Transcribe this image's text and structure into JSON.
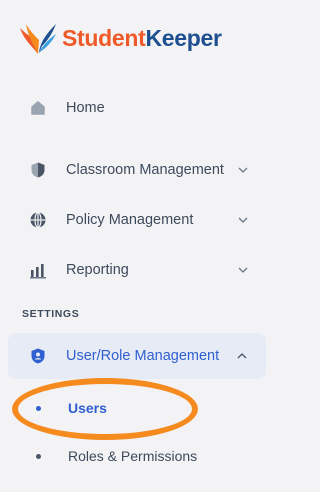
{
  "brand": {
    "part1": "Student",
    "part2": "Keeper"
  },
  "nav": {
    "home": "Home",
    "classroom": "Classroom Management",
    "policy": "Policy Management",
    "reporting": "Reporting"
  },
  "settings": {
    "section_label": "SETTINGS",
    "group_label": "User/Role Management",
    "items": [
      "Users",
      "Roles & Permissions"
    ]
  },
  "colors": {
    "accent": "#2f5fd0",
    "brand_orange": "#f05a28",
    "brand_navy": "#1d4f91",
    "highlight": "#f58a1f"
  }
}
